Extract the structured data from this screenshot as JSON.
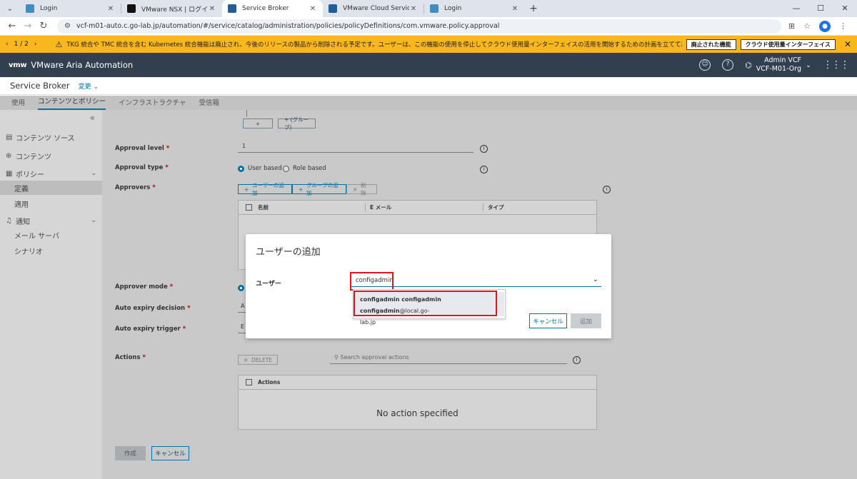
{
  "browser": {
    "tabs": [
      {
        "title": "Login",
        "color": "#3f8ec2"
      },
      {
        "title": "VMware NSX | ログイン",
        "color": "#111111"
      },
      {
        "title": "Service Broker",
        "color": "#1f5f99"
      },
      {
        "title": "VMware Cloud Services",
        "color": "#1f5f99"
      },
      {
        "title": "Login",
        "color": "#3f8ec2"
      }
    ],
    "url": "vcf-m01-auto.c.go-lab.jp/automation/#/service/catalog/administration/policies/policyDefinitions/com.vmware.policy.approval"
  },
  "banner": {
    "pager": "1 / 2",
    "message": "TKG 統合や TMC 統合を含む Kubernetes 統合機能は廃止され、今後のリリースの製品から削除される予定です。ユーザーは、この機能の使用を停止してクラウド使用量インターフェイスの活用を開始するための計画を立てておく必要があります。",
    "button1": "廃止された機能",
    "button2": "クラウド使用量インターフェイス",
    "color": "#f8b71c"
  },
  "header": {
    "logo": "vmw",
    "title": "VMware Aria Automation",
    "user_name": "Admin VCF",
    "org": "VCF-M01-Org"
  },
  "subheader": {
    "title": "Service Broker",
    "change": "変更"
  },
  "navtabs": [
    "使用",
    "コンテンツとポリシー",
    "インフラストラクチャ",
    "受信箱"
  ],
  "sidebar": {
    "items": [
      {
        "label": "コンテンツ ソース"
      },
      {
        "label": "コンテンツ"
      },
      {
        "label": "ポリシー"
      },
      {
        "label": "定義"
      },
      {
        "label": "適用"
      },
      {
        "label": "通知"
      },
      {
        "label": "メール サーバ"
      },
      {
        "label": "シナリオ"
      }
    ]
  },
  "form": {
    "btn_plus": "+",
    "btn_group": "+ (グループ)",
    "approval_level_label": "Approval level",
    "approval_level_value": "1",
    "approval_type_label": "Approval type",
    "user_based": "User based",
    "role_based": "Role based",
    "approvers_label": "Approvers",
    "add_user": "ユーザーの追加",
    "add_group": "グループの追加",
    "delete": "削除",
    "col_name": "名前",
    "col_email": "E メール",
    "col_type": "タイプ",
    "approver_mode_label": "Approver mode",
    "auto_expiry_decision_label": "Auto expiry decision",
    "auto_expiry_decision_value": "A",
    "auto_expiry_trigger_label": "Auto expiry trigger",
    "auto_expiry_trigger_value": "E",
    "actions_label": "Actions",
    "delete_upper": "DELETE",
    "search_placeholder": "Search approval actions",
    "col_actions": "Actions",
    "no_action": "No action specified",
    "create": "作成",
    "cancel": "キャンセル"
  },
  "modal": {
    "title": "ユーザーの追加",
    "user_label": "ユーザー",
    "user_value": "configadmin",
    "option_bold": "configadmin configadmin configadmin",
    "option_email_1": "@local.go-",
    "option_email_2": "lab.jp",
    "cancel": "キャンセル",
    "add": "追加"
  },
  "colors": {
    "accent": "#0072a3",
    "highlight": "#e3141c",
    "header_bg": "#313f4e"
  }
}
